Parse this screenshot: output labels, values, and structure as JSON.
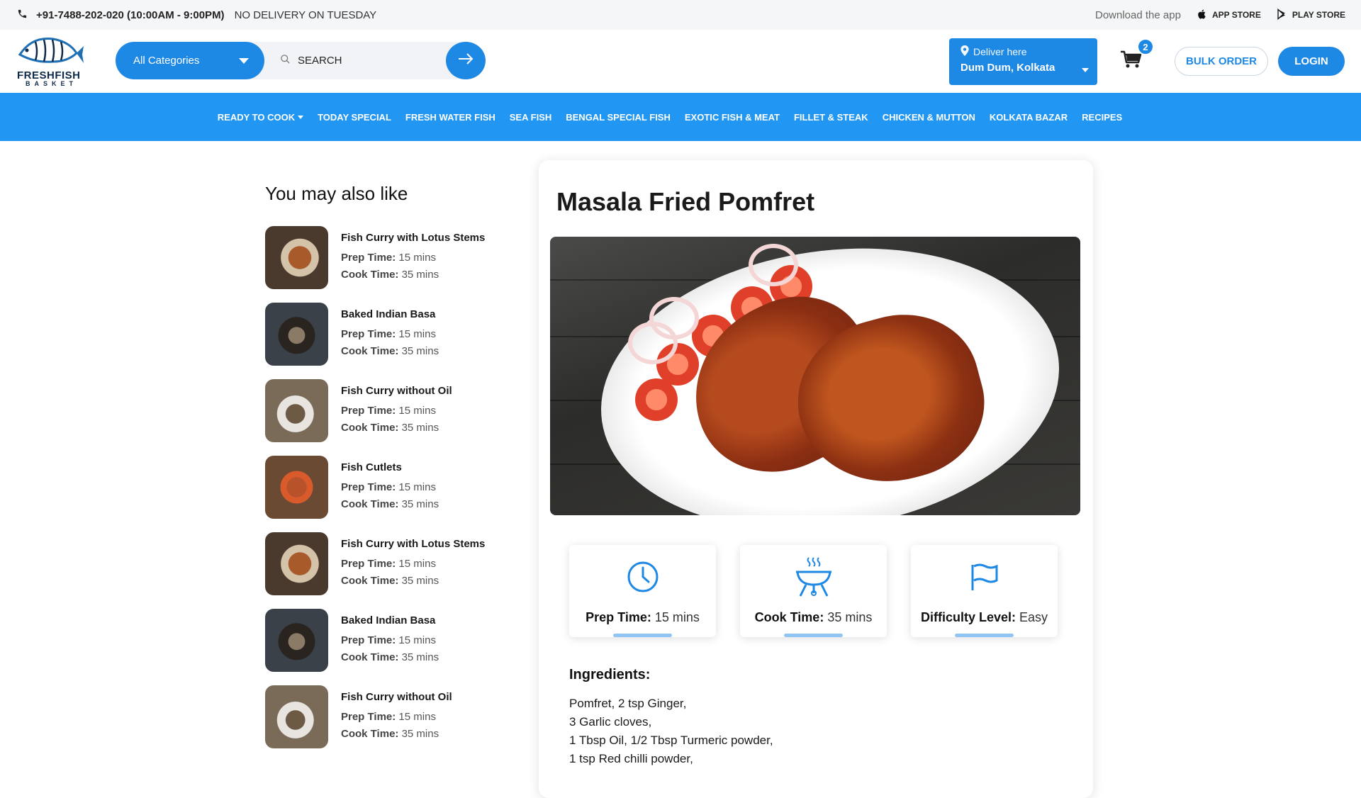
{
  "topbar": {
    "phone": "+91-7488-202-020 (10:00AM - 9:00PM)",
    "notice": "NO DELIVERY ON TUESDAY",
    "download": "Download the app",
    "app_store": "APP STORE",
    "play_store": "PLAY STORE"
  },
  "header": {
    "logo_line1": "FRESHFISH",
    "logo_line2": "BASKET",
    "category_label": "All Categories",
    "search_placeholder": "SEARCH",
    "deliver_label": "Deliver here",
    "deliver_location": "Dum Dum, Kolkata",
    "cart_count": "2",
    "bulk_order": "BULK ORDER",
    "login": "LOGIN"
  },
  "nav": {
    "items": [
      "READY TO COOK",
      "TODAY SPECIAL",
      "FRESH WATER FISH",
      "SEA FISH",
      "BENGAL SPECIAL FISH",
      "EXOTIC FISH & MEAT",
      "FILLET & STEAK",
      "CHICKEN & MUTTON",
      "KOLKATA BAZAR",
      "RECIPES"
    ]
  },
  "sidebar": {
    "title": "You may also like",
    "prep_label": "Prep Time:",
    "cook_label": "Cook Time:",
    "items": [
      {
        "title": "Fish Curry with Lotus Stems",
        "prep": "15 mins",
        "cook": "35 mins"
      },
      {
        "title": "Baked Indian Basa",
        "prep": "15 mins",
        "cook": "35 mins"
      },
      {
        "title": "Fish Curry without Oil",
        "prep": "15 mins",
        "cook": "35 mins"
      },
      {
        "title": "Fish Cutlets",
        "prep": "15 mins",
        "cook": "35 mins"
      },
      {
        "title": "Fish Curry with Lotus Stems",
        "prep": "15 mins",
        "cook": "35 mins"
      },
      {
        "title": "Baked Indian Basa",
        "prep": "15 mins",
        "cook": "35 mins"
      },
      {
        "title": "Fish Curry without Oil",
        "prep": "15 mins",
        "cook": "35 mins"
      }
    ]
  },
  "recipe": {
    "title": "Masala Fried Pomfret",
    "stats": {
      "prep_label": "Prep Time:",
      "prep_value": "15 mins",
      "cook_label": "Cook Time:",
      "cook_value": "35 mins",
      "difficulty_label": "Difficulty Level:",
      "difficulty_value": "Easy"
    },
    "ingredients_title": "Ingredients:",
    "ingredients": [
      "Pomfret, 2 tsp Ginger,",
      "3 Garlic cloves,",
      "1 Tbsp Oil, 1/2 Tbsp Turmeric powder,",
      "1 tsp Red chilli powder,"
    ]
  },
  "colors": {
    "primary": "#1e88e5",
    "nav": "#2196f3",
    "accent_bar": "#90c4f3"
  }
}
